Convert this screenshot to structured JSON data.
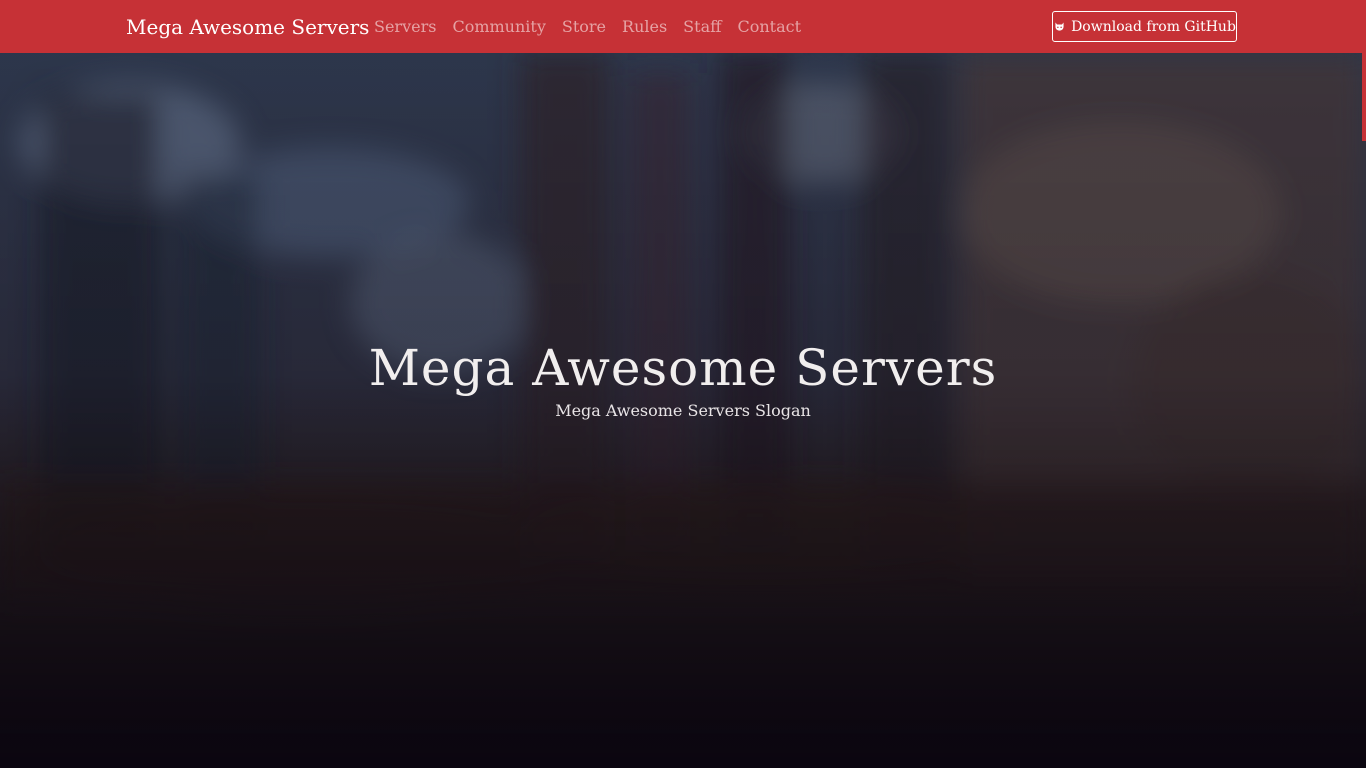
{
  "navbar": {
    "brand": "Mega Awesome Servers",
    "links": [
      "Servers",
      "Community",
      "Store",
      "Rules",
      "Staff",
      "Contact"
    ],
    "github_button": "Download from GitHub",
    "github_icon": "github-icon",
    "color": "#c63136"
  },
  "hero": {
    "title": "Mega Awesome Servers",
    "slogan": "Mega Awesome Servers Slogan"
  }
}
